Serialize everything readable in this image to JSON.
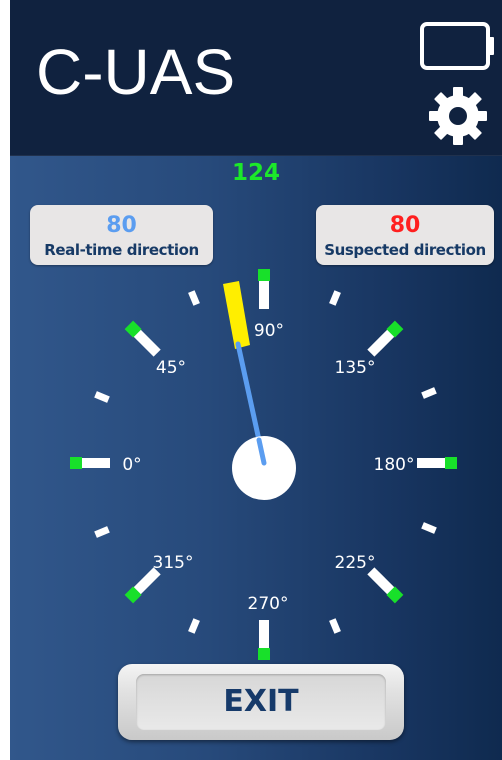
{
  "app": {
    "title": "C-UAS"
  },
  "header": {
    "battery_icon": "battery-icon",
    "settings_icon": "gear-icon"
  },
  "heading_readout": "124",
  "realtime": {
    "value": "80",
    "label": "Real-time direction",
    "color": "#5b9df0"
  },
  "suspected": {
    "value": "80",
    "label": "Suspected direction",
    "color": "#ff1f1f"
  },
  "compass": {
    "labels": {
      "deg0": "0°",
      "deg45": "45°",
      "deg90": "90°",
      "deg135": "135°",
      "deg180": "180°",
      "deg225": "225°",
      "deg270": "270°",
      "deg315": "315°"
    },
    "needle_color": "#5b9df0",
    "marker_color": "#ffee00",
    "major_tick_accent": "#18e02a"
  },
  "exit_label": "EXIT"
}
